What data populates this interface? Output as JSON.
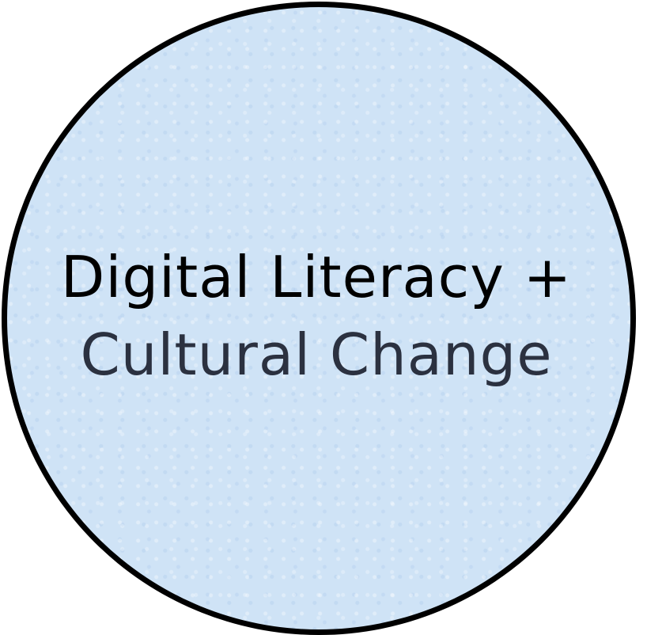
{
  "concept": {
    "line1": "Digital Literacy +",
    "line2": "Cultural Change"
  },
  "colors": {
    "fill": "#cfe3f6",
    "border": "#000000",
    "line1_text": "#000000",
    "line2_text": "#2b3140"
  }
}
